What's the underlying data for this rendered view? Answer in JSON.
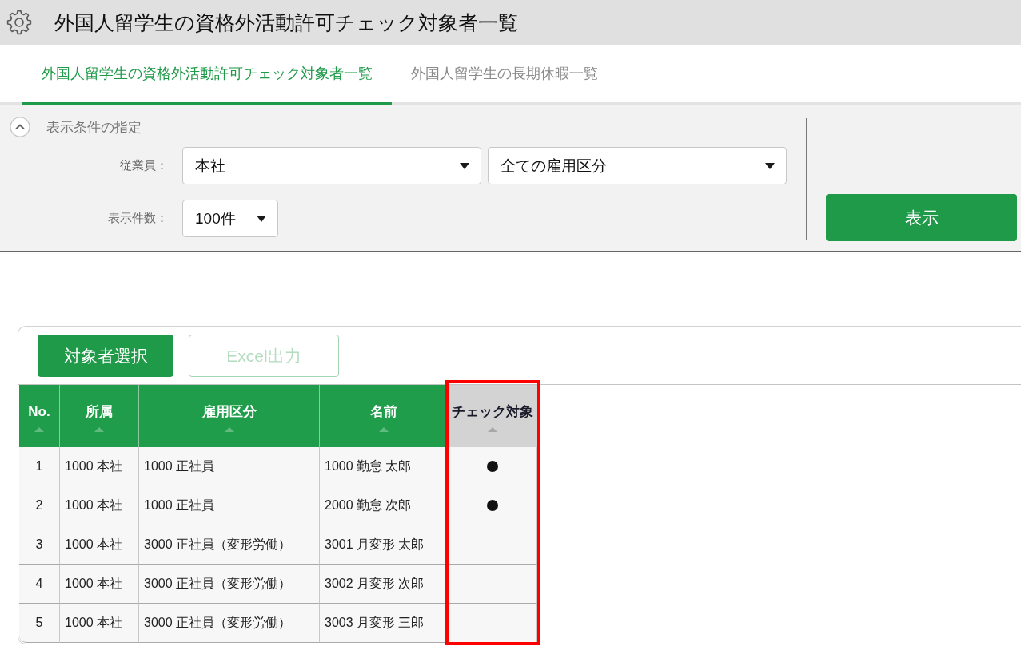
{
  "header": {
    "title": "外国人留学生の資格外活動許可チェック対象者一覧"
  },
  "tabs": [
    {
      "label": "外国人留学生の資格外活動許可チェック対象者一覧",
      "selected": true
    },
    {
      "label": "外国人留学生の長期休暇一覧",
      "selected": false
    }
  ],
  "filter_panel": {
    "title": "表示条件の指定",
    "expanded": true,
    "fields": [
      {
        "label": "従業員：",
        "dropdowns": [
          "本社",
          "全ての雇用区分"
        ]
      },
      {
        "label": "表示件数：",
        "dropdowns": [
          "100件"
        ]
      }
    ],
    "submit_button": "表示"
  },
  "actions": [
    {
      "label": "対象者選択",
      "disabled": false
    },
    {
      "label": "Excel出力",
      "disabled": true
    }
  ],
  "table": {
    "columns": [
      {
        "label": "No.",
        "kind": "index",
        "highlighted": false
      },
      {
        "label": "所属",
        "kind": "text",
        "highlighted": false
      },
      {
        "label": "雇用区分",
        "kind": "text",
        "highlighted": false
      },
      {
        "label": "名前",
        "kind": "text",
        "highlighted": false
      },
      {
        "label": "チェック対象",
        "kind": "mark",
        "highlighted": true
      }
    ],
    "rows": [
      {
        "cells": [
          "1",
          "1000 本社",
          "1000 正社員",
          "1000 勤怠 太郎"
        ],
        "check_target": true
      },
      {
        "cells": [
          "2",
          "1000 本社",
          "1000 正社員",
          "2000 勤怠 次郎"
        ],
        "check_target": true
      },
      {
        "cells": [
          "3",
          "1000 本社",
          "3000 正社員（変形労働）",
          "3001 月変形 太郎"
        ],
        "check_target": false
      },
      {
        "cells": [
          "4",
          "1000 本社",
          "3000 正社員（変形労働）",
          "3002 月変形 次郎"
        ],
        "check_target": false
      },
      {
        "cells": [
          "5",
          "1000 本社",
          "3000 正社員（変形労働）",
          "3003 月変形 三郎"
        ],
        "check_target": false
      }
    ]
  }
}
